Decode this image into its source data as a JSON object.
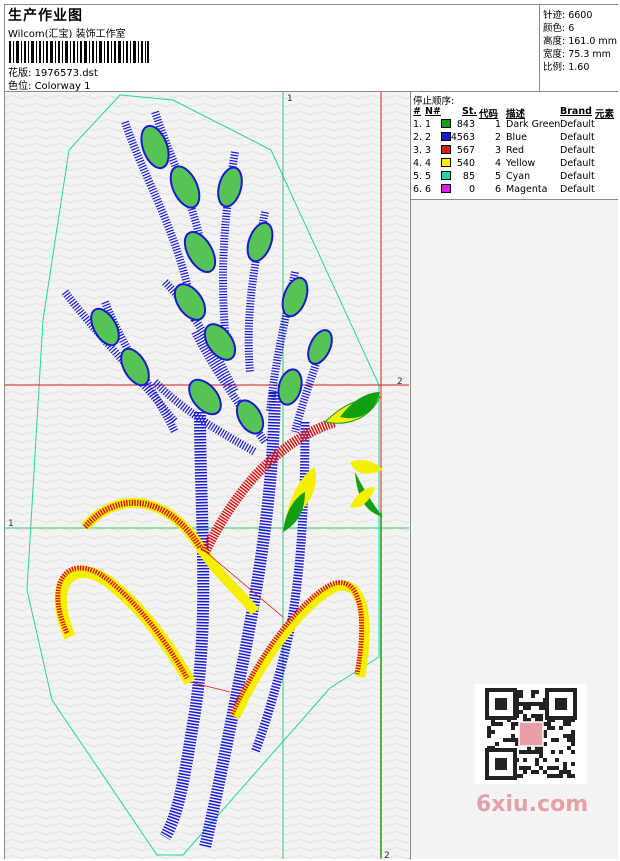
{
  "header": {
    "title": "生产作业图",
    "company": "Wilcom(汇宝) 装饰工作室",
    "file_label": "花版:",
    "file_value": "1976573.dst",
    "colorway_label": "色位:",
    "colorway_value": "Colorway 1"
  },
  "stats": {
    "stitches": "针迹: 6600",
    "colors": "颜色: 6",
    "height": "高度: 161.0 mm",
    "width": "宽度: 75.3 mm",
    "scale": "比例: 1.60"
  },
  "stop_sequence": {
    "title": "停止顺序:",
    "headers": [
      "#",
      "N#",
      "St.",
      "代码",
      "描述",
      "Brand",
      "元素"
    ],
    "rows": [
      {
        "index": "1.",
        "n": "1",
        "color": "#12a012",
        "stitches": "843",
        "code": "1",
        "desc": "Dark Green",
        "brand": "Default"
      },
      {
        "index": "2.",
        "n": "2",
        "color": "#1a1ad2",
        "stitches": "4563",
        "code": "2",
        "desc": "Blue",
        "brand": "Default"
      },
      {
        "index": "3.",
        "n": "3",
        "color": "#e01515",
        "stitches": "567",
        "code": "3",
        "desc": "Red",
        "brand": "Default"
      },
      {
        "index": "4.",
        "n": "4",
        "color": "#f5f000",
        "stitches": "540",
        "code": "4",
        "desc": "Yellow",
        "brand": "Default"
      },
      {
        "index": "5.",
        "n": "5",
        "color": "#1fd6a0",
        "stitches": "85",
        "code": "5",
        "desc": "Cyan",
        "brand": "Default"
      },
      {
        "index": "6.",
        "n": "6",
        "color": "#e619e6",
        "stitches": "0",
        "code": "6",
        "desc": "Magenta",
        "brand": "Default"
      }
    ]
  },
  "canvas": {
    "guide_labels": {
      "top_1": "1",
      "right_2": "2",
      "left_1": "1",
      "bottom_2": "2"
    }
  },
  "watermark": "6xiu.com"
}
